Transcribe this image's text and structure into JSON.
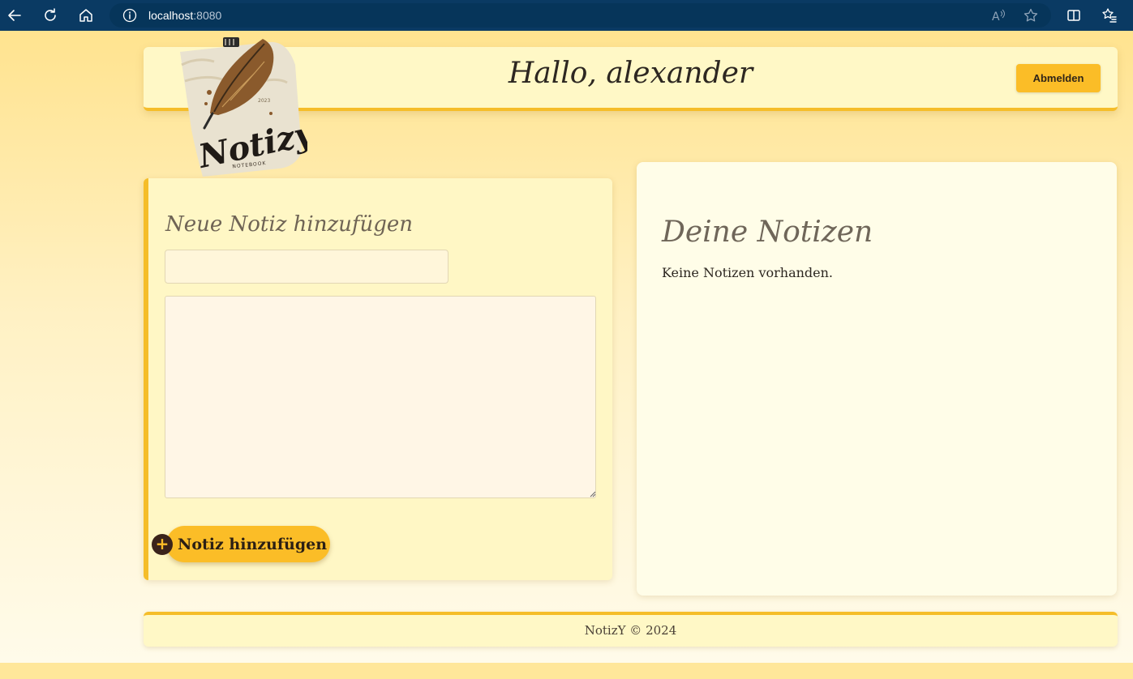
{
  "browser": {
    "url_host": "localhost",
    "url_port": ":8080",
    "icons": [
      "back-arrow-icon",
      "refresh-icon",
      "home-icon",
      "info-icon",
      "read-aloud-icon",
      "favorite-star-icon",
      "split-screen-icon",
      "favorites-list-icon"
    ]
  },
  "header": {
    "greeting": "Hallo, alexander",
    "logout_label": "Abmelden"
  },
  "logo": {
    "text": "Notizy",
    "subtext": "NOTEBOOK",
    "year": "2023"
  },
  "new_note": {
    "title": "Neue Notiz hinzufügen",
    "title_value": "",
    "content_value": "",
    "submit_label": "Notiz hinzufügen",
    "submit_icon": "plus-circle-icon"
  },
  "notes": {
    "title": "Deine Notizen",
    "empty_message": "Keine Notizen vorhanden."
  },
  "footer": {
    "text": "NotizY © 2024"
  },
  "colors": {
    "accent": "#fbbd27",
    "browser_bar": "#0a3a63",
    "card_bg": "#fff7c5"
  }
}
